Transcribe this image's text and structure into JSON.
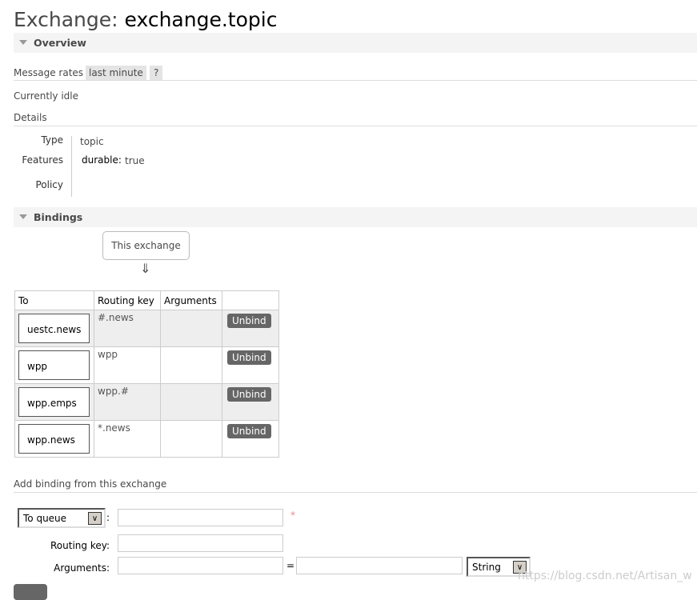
{
  "title": {
    "prefix": "Exchange:",
    "name": "exchange.topic"
  },
  "overview": {
    "header": "Overview",
    "message_rates_label": "Message rates",
    "range": "last minute",
    "help": "?",
    "status": "Currently idle",
    "details_label": "Details",
    "details": {
      "type_label": "Type",
      "type_value": "topic",
      "features_label": "Features",
      "feature_key": "durable:",
      "feature_value": "true",
      "policy_label": "Policy"
    }
  },
  "bindings": {
    "header": "Bindings",
    "source": "This exchange",
    "arrow": "⇓",
    "columns": [
      "To",
      "Routing key",
      "Arguments",
      ""
    ],
    "rows": [
      {
        "to": "uestc.news",
        "routing_key": "#.news",
        "arguments": "",
        "action": "Unbind"
      },
      {
        "to": "wpp",
        "routing_key": "wpp",
        "arguments": "",
        "action": "Unbind"
      },
      {
        "to": "wpp.emps",
        "routing_key": "wpp.#",
        "arguments": "",
        "action": "Unbind"
      },
      {
        "to": "wpp.news",
        "routing_key": "*.news",
        "arguments": "",
        "action": "Unbind"
      }
    ]
  },
  "add_binding": {
    "header": "Add binding from this exchange",
    "destination_type": "To queue",
    "colon": ":",
    "required": "*",
    "routing_key_label": "Routing key:",
    "arguments_label": "Arguments:",
    "equals": "=",
    "arg_type": "String"
  },
  "watermark": "https://blog.csdn.net/Artisan_w"
}
